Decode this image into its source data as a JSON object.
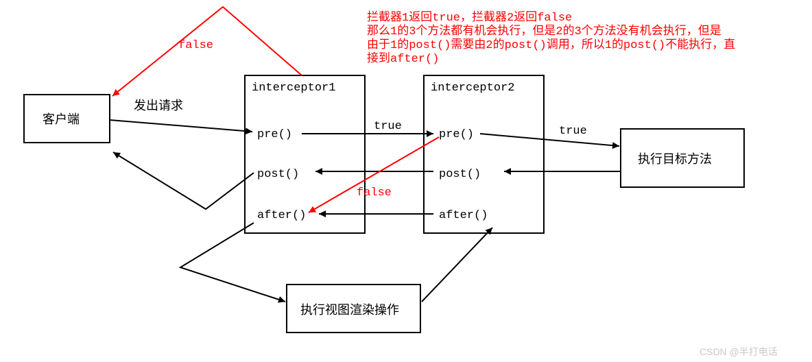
{
  "boxes": {
    "client": "客户端",
    "int1": {
      "title": "interceptor1",
      "pre": "pre()",
      "post": "post()",
      "after": "after()"
    },
    "int2": {
      "title": "interceptor2",
      "pre": "pre()",
      "post": "post()",
      "after": "after()"
    },
    "target": "执行目标方法",
    "render": "执行视图渲染操作"
  },
  "labels": {
    "request": "发出请求",
    "true1": "true",
    "true2": "true",
    "false_top": "false",
    "false_mid": "false"
  },
  "note": {
    "l1": "拦截器1返回true，拦截器2返回false",
    "l2": "那么1的3个方法都有机会执行，但是2的3个方法没有机会执行，但是",
    "l3": "由于1的post()需要由2的post()调用，所以1的post()不能执行，直",
    "l4": "接到after()"
  },
  "watermark": "CSDN @半打电话"
}
